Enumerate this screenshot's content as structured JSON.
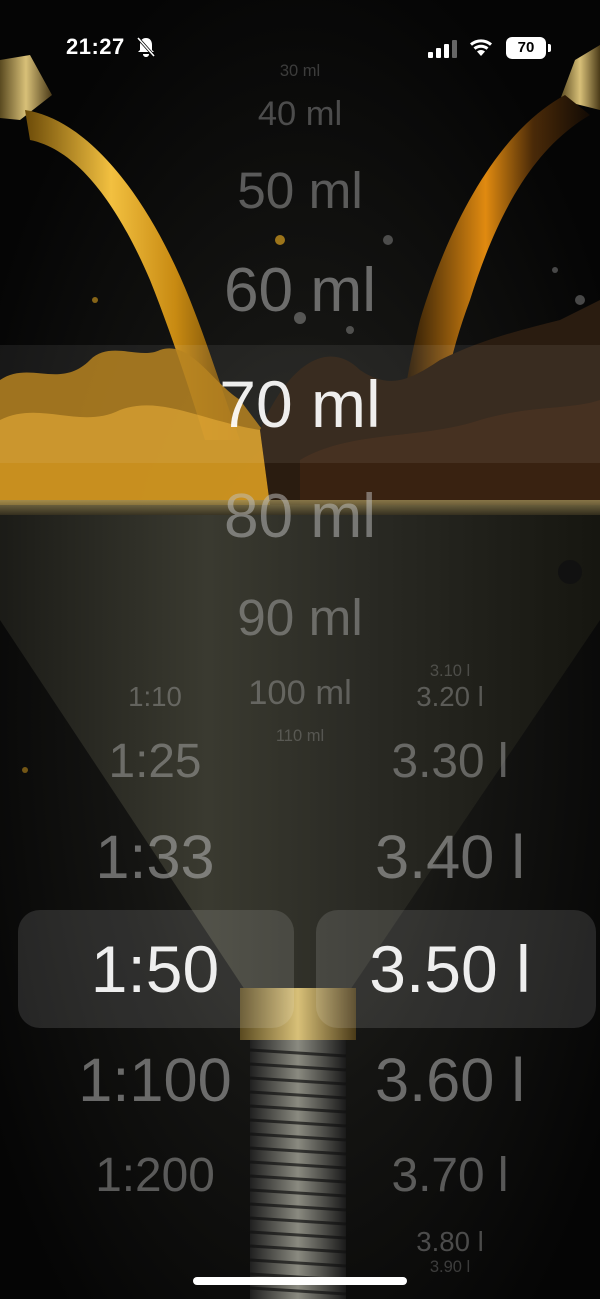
{
  "status_bar": {
    "time": "21:27",
    "battery": "70"
  },
  "volume_picker": {
    "items": [
      "30 ml",
      "40 ml",
      "50 ml",
      "60 ml",
      "70 ml",
      "80 ml",
      "90 ml",
      "100 ml",
      "110 ml"
    ],
    "selected": "70 ml"
  },
  "ratio_picker": {
    "items": [
      "1:10",
      "1:25",
      "1:33",
      "1:50",
      "1:100",
      "1:200"
    ],
    "selected": "1:50"
  },
  "fuel_picker": {
    "items": [
      "3.10 l",
      "3.20 l",
      "3.30 l",
      "3.40 l",
      "3.50 l",
      "3.60 l",
      "3.70 l",
      "3.80 l",
      "3.90 l"
    ],
    "selected": "3.50 l"
  },
  "background": {
    "description_icon": "oil-funnel-image"
  }
}
